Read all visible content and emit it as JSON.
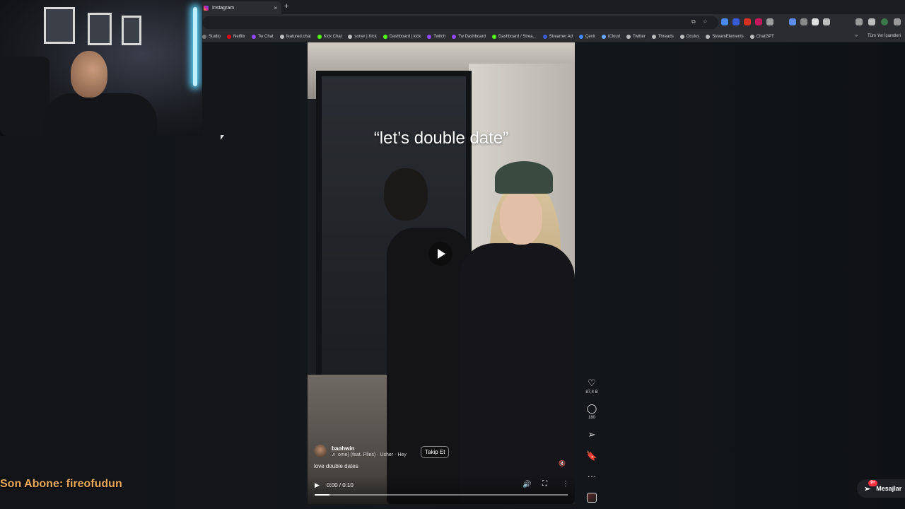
{
  "browser": {
    "tab": {
      "title": "Instagram",
      "close": "×"
    },
    "new_tab": "+",
    "bookmarks": [
      {
        "label": "Studio",
        "color": "#7a7a7a"
      },
      {
        "label": "Netflix",
        "color": "#e50914"
      },
      {
        "label": "Tw Chat",
        "color": "#9146ff"
      },
      {
        "label": "featured.chat",
        "color": "#bdbdbd"
      },
      {
        "label": "Kick Chat",
        "color": "#53fc18"
      },
      {
        "label": "soner | Kick",
        "color": "#bdbdbd"
      },
      {
        "label": "Dashboard | kick",
        "color": "#53fc18"
      },
      {
        "label": "Twitch",
        "color": "#9146ff"
      },
      {
        "label": "Tw Dashboard",
        "color": "#9146ff"
      },
      {
        "label": "Dashboard / Strea...",
        "color": "#53fc18"
      },
      {
        "label": "Streamer Ad",
        "color": "#3b5bdb"
      },
      {
        "label": "Çevir",
        "color": "#4285f4"
      },
      {
        "label": "iCloud",
        "color": "#6aa8ff"
      },
      {
        "label": "Twitter",
        "color": "#bdbdbd"
      },
      {
        "label": "Threads",
        "color": "#bdbdbd"
      },
      {
        "label": "Oculus",
        "color": "#bdbdbd"
      },
      {
        "label": "StreamElements",
        "color": "#bdbdbd"
      },
      {
        "label": "ChatGPT",
        "color": "#bdbdbd"
      }
    ],
    "bookmarks_more": "»",
    "all_bookmarks": "Tüm Yer İşaretleri"
  },
  "reel": {
    "caption_overlay": "“let’s double date”",
    "username": "baohwin",
    "audio": "♬ ome) (feat. Plies) · Usher · Hey",
    "follow_label": "Takip Et",
    "description": "love double dates",
    "time": "0:00 / 0:10",
    "progress": 0.06,
    "icons": {
      "play": "▶",
      "volume": "🔊",
      "fullscreen": "⛶",
      "more": "⋮",
      "mute": "🔇"
    }
  },
  "actions": {
    "like": {
      "icon": "♡",
      "count": "87,4 B"
    },
    "comment": {
      "icon": "◯",
      "count": "180"
    },
    "share": {
      "icon": "➢"
    },
    "save": {
      "icon": "🔖"
    },
    "more": {
      "icon": "···"
    }
  },
  "overlay": {
    "sub_banner": "Son Abone: fireofudun"
  },
  "messages": {
    "label": "Mesajlar",
    "badge": "9+",
    "icon": "➢"
  }
}
